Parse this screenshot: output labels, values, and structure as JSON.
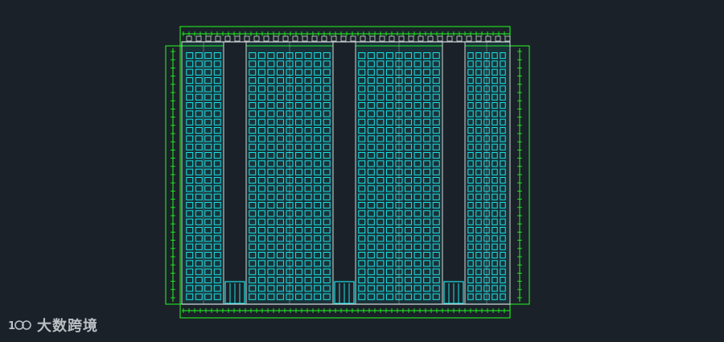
{
  "title": "",
  "colors": {
    "background": "#1b2128",
    "dimension_lines": "#22ff22",
    "windows": "#19e3e8",
    "walls": "#d0d8d8",
    "facade": "#0f7f86"
  },
  "drawing": {
    "type": "CAD building elevation",
    "towers": 3,
    "floors": 30
  },
  "watermark": {
    "logo": "100-logo-icon",
    "text": "大数跨境"
  }
}
